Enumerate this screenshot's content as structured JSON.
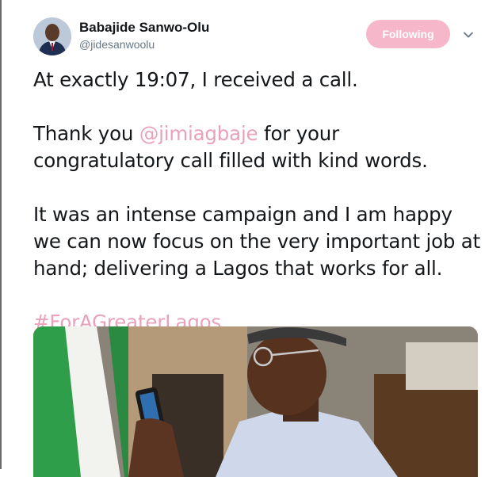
{
  "user": {
    "display_name": "Babajide Sanwo-Olu",
    "handle": "@jidesanwoolu"
  },
  "actions": {
    "follow_label": "Following"
  },
  "icons": {
    "avatar": "avatar-photo",
    "menu": "chevron-down-icon"
  },
  "tweet": {
    "line1": "At exactly 19:07, I  received a call.",
    "p2_prefix": "Thank you ",
    "p2_mention": "@jimiagbaje",
    "p2_suffix": " for your congratulatory call filled with kind words.",
    "p3": "It was an intense campaign and I am happy we can now focus on the very important job at hand; delivering a Lagos that works for all.",
    "hashtag": "#ForAGreaterLagos"
  },
  "colors": {
    "link": "#e9a2b8",
    "follow_button": "#f5b7c9",
    "text": "#14171a",
    "secondary_text": "#657786"
  }
}
